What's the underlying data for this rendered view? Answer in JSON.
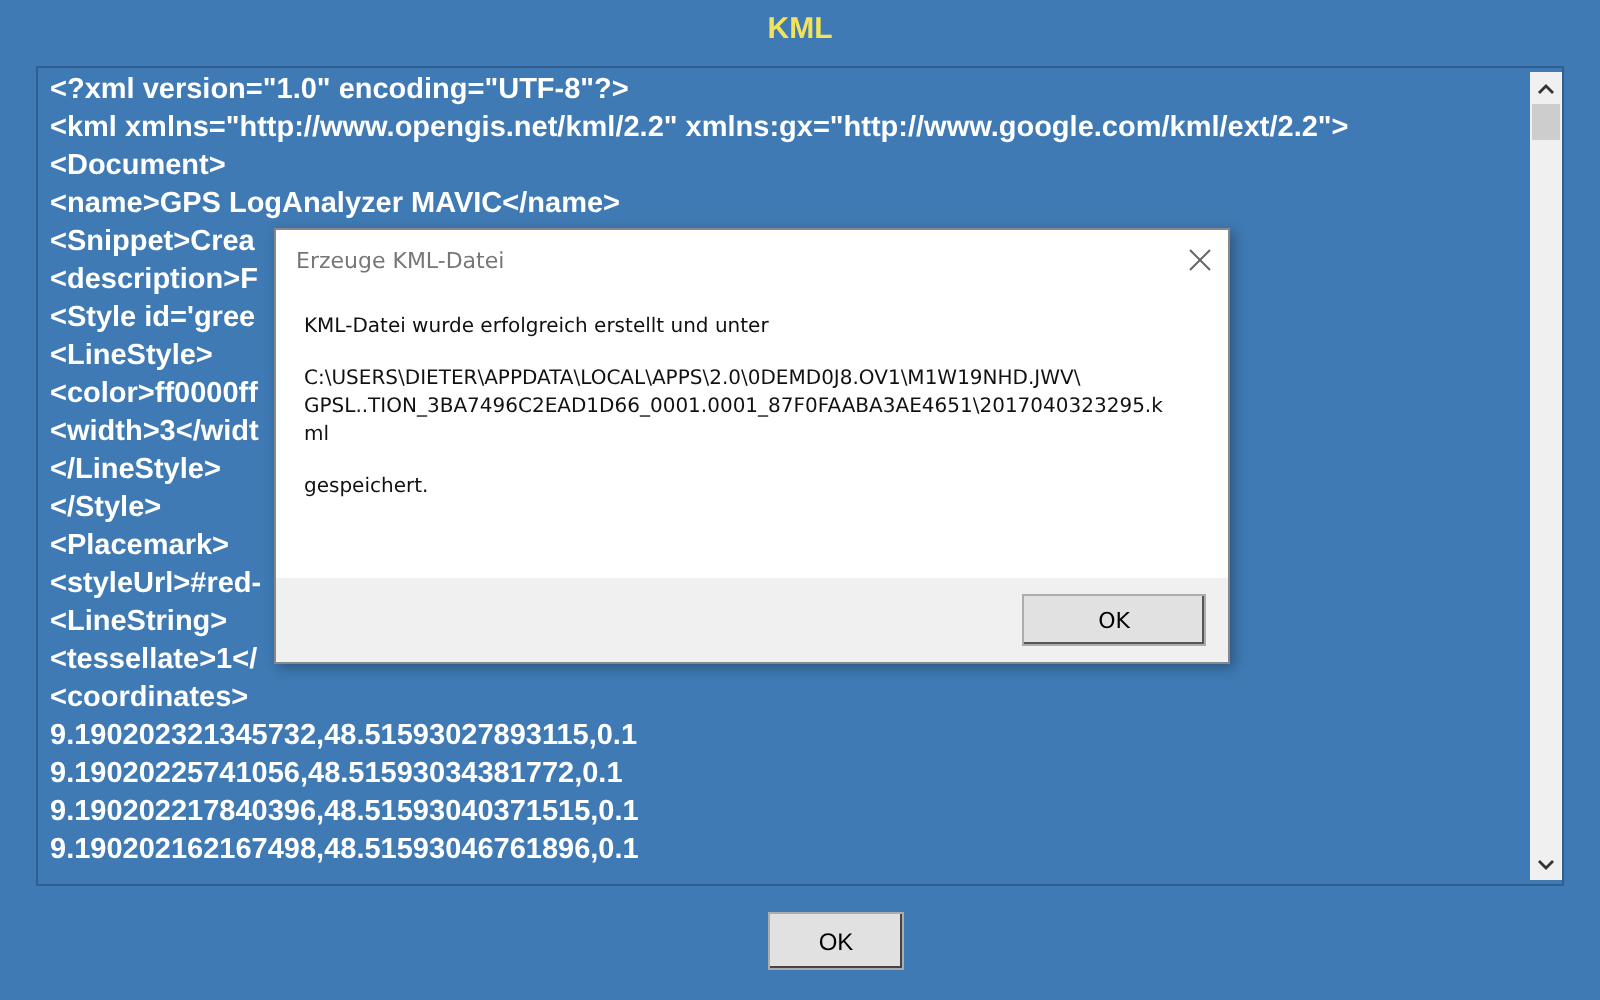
{
  "window": {
    "title": "KML"
  },
  "content_lines": [
    "<?xml version=\"1.0\" encoding=\"UTF-8\"?>",
    "<kml xmlns=\"http://www.opengis.net/kml/2.2\" xmlns:gx=\"http://www.google.com/kml/ext/2.2\">",
    "<Document>",
    "<name>GPS LogAnalyzer MAVIC</name>",
    "<Snippet>Crea",
    "<description>F",
    "<Style id='gree",
    "<LineStyle>",
    "<color>ff0000ff",
    "<width>3</widt",
    "</LineStyle>",
    "</Style>",
    "<Placemark>",
    "<styleUrl>#red-",
    "<LineString>",
    "<tessellate>1</",
    "<coordinates>",
    "9.190202321345732,48.51593027893115,0.1",
    "9.19020225741056,48.51593034381772,0.1",
    "9.190202217840396,48.51593040371515,0.1",
    "9.190202162167498,48.51593046761896,0.1"
  ],
  "ok_button": "OK",
  "dialog": {
    "title": "Erzeuge KML-Datei",
    "message_lines": [
      "KML-Datei wurde erfolgreich erstellt und unter",
      "C:\\USERS\\DIETER\\APPDATA\\LOCAL\\APPS\\2.0\\0DEMD0J8.OV1\\M1W19NHD.JWV\\\nGPSL..TION_3BA7496C2EAD1D66_0001.0001_87F0FAABA3AE4651\\2017040323295.k\nml",
      "gespeichert."
    ],
    "ok_button": "OK"
  }
}
